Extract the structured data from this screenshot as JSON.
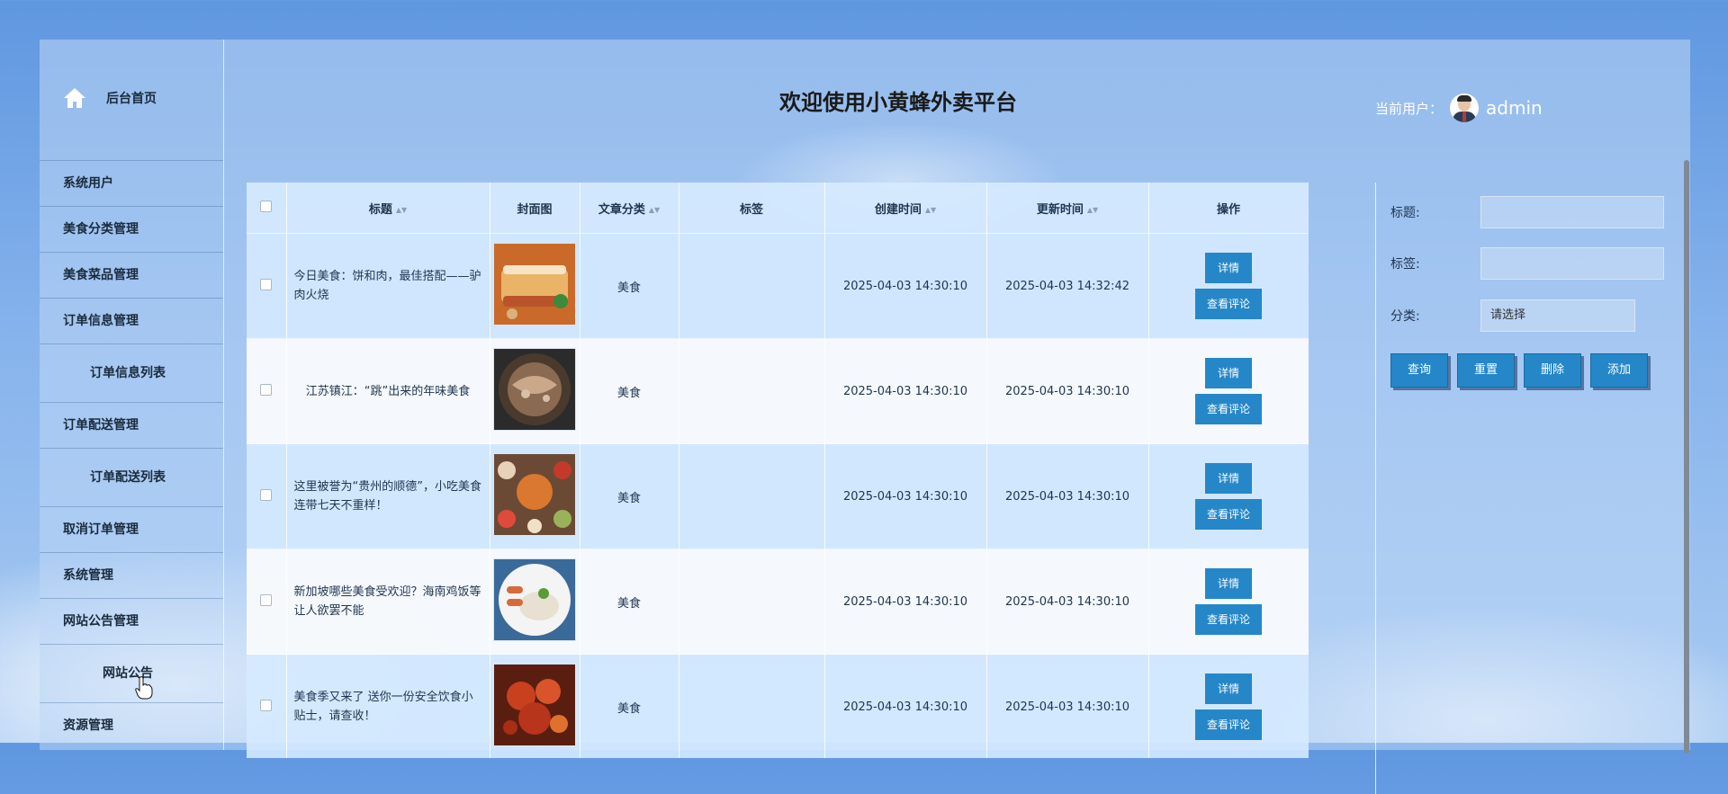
{
  "sidebar": {
    "home_label": "后台首页",
    "items": [
      {
        "label": "系统用户"
      },
      {
        "label": "美食分类管理"
      },
      {
        "label": "美食菜品管理"
      },
      {
        "label": "订单信息管理"
      },
      {
        "label": "订单信息列表"
      },
      {
        "label": "订单配送管理"
      },
      {
        "label": "订单配送列表"
      },
      {
        "label": "取消订单管理"
      },
      {
        "label": "系统管理"
      },
      {
        "label": "网站公告管理"
      },
      {
        "label": "网站公告"
      },
      {
        "label": "资源管理"
      }
    ]
  },
  "header": {
    "title": "欢迎使用小黄蜂外卖平台",
    "user_label": "当前用户：",
    "user_name": "admin"
  },
  "table": {
    "headers": {
      "title": "标题",
      "cover": "封面图",
      "category": "文章分类",
      "tags": "标签",
      "created": "创建时间",
      "updated": "更新时间",
      "actions": "操作"
    },
    "detail_label": "详情",
    "comments_label": "查看评论",
    "rows": [
      {
        "title": "今日美食：饼和肉，最佳搭配——驴肉火烧",
        "category": "美食",
        "tags": "",
        "created": "2025-04-03 14:30:10",
        "updated": "2025-04-03 14:32:42"
      },
      {
        "title": "江苏镇江：“跳”出来的年味美食",
        "category": "美食",
        "tags": "",
        "created": "2025-04-03 14:30:10",
        "updated": "2025-04-03 14:30:10"
      },
      {
        "title": "这里被誉为“贵州的顺德”，小吃美食连带七天不重样！",
        "category": "美食",
        "tags": "",
        "created": "2025-04-03 14:30:10",
        "updated": "2025-04-03 14:30:10"
      },
      {
        "title": "新加坡哪些美食受欢迎？海南鸡饭等让人欲罢不能",
        "category": "美食",
        "tags": "",
        "created": "2025-04-03 14:30:10",
        "updated": "2025-04-03 14:30:10"
      },
      {
        "title": "美食季又来了 送你一份安全饮食小贴士，请查收！",
        "category": "美食",
        "tags": "",
        "created": "2025-04-03 14:30:10",
        "updated": "2025-04-03 14:30:10"
      }
    ]
  },
  "search": {
    "title_label": "标题:",
    "tags_label": "标签:",
    "category_label": "分类:",
    "title_value": "",
    "tags_value": "",
    "category_value": "请选择",
    "query_btn": "查询",
    "reset_btn": "重置",
    "delete_btn": "删除",
    "add_btn": "添加"
  },
  "colors": {
    "accent": "#2587c8",
    "background": "#86b3ec"
  }
}
